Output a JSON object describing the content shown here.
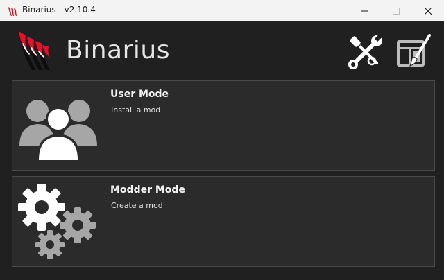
{
  "window": {
    "title": "Binarius - v2.10.4",
    "controls": {
      "minimize": "minimize",
      "maximize": "maximize",
      "close": "close"
    }
  },
  "header": {
    "app_name": "Binarius",
    "logo_icon": "binarius-flame-logo",
    "actions": [
      {
        "name": "tools",
        "icon": "wrench-screwdriver-icon"
      },
      {
        "name": "theme",
        "icon": "paint-brush-icon"
      }
    ]
  },
  "modes": [
    {
      "title": "User Mode",
      "description": "Install a mod",
      "icon": "users-icon"
    },
    {
      "title": "Modder Mode",
      "description": "Create a mod",
      "icon": "gears-icon"
    }
  ],
  "colors": {
    "background": "#202020",
    "card": "#2b2b2b",
    "card_border": "#4a4a4a",
    "icon_gray": "#bdbdbd",
    "logo_red": "#e8102a",
    "titlebar": "#f3f3f3"
  }
}
